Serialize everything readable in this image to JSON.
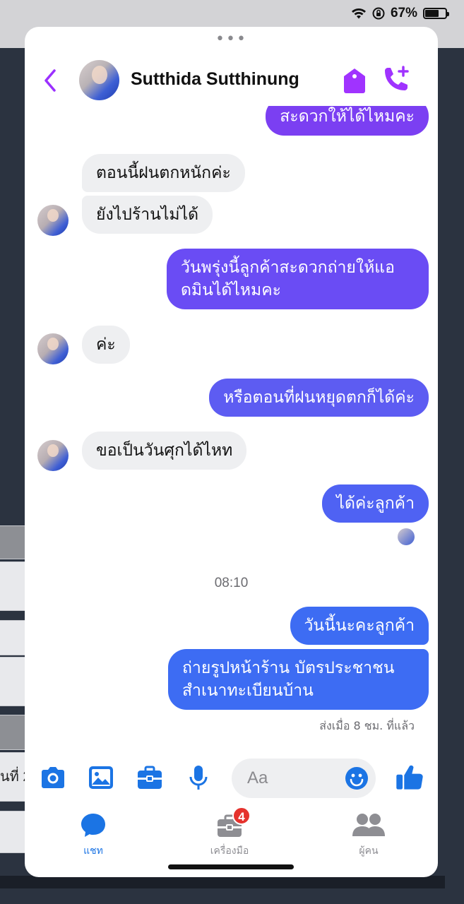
{
  "status_bar": {
    "battery": "67%",
    "battery_level": 0.67
  },
  "background": {
    "side_text": "นที่ 2"
  },
  "header": {
    "contact_name": "Sutthida Sutthinung",
    "accent_color": "#a033ff"
  },
  "messages": [
    {
      "from": "me",
      "lines": [
        "สะดวกให้ได้ไหมคะ"
      ]
    },
    {
      "from": "them",
      "lines": [
        "ตอนนี้ฝนตกหนักค่ะ"
      ]
    },
    {
      "from": "them",
      "lines": [
        "ยังไปร้านไม่ได้"
      ]
    },
    {
      "from": "me",
      "lines": [
        "วันพรุ่งนี้ลูกค้าสะดวกถ่ายให้แอ",
        "ดมินได้ไหมคะ"
      ]
    },
    {
      "from": "them",
      "lines": [
        "ค่ะ"
      ]
    },
    {
      "from": "me",
      "lines": [
        "หรือตอนที่ฝนหยุดตกก็ได้ค่ะ"
      ]
    },
    {
      "from": "them",
      "lines": [
        "ขอเป็นวันศุกได้ไหท"
      ]
    },
    {
      "from": "me",
      "lines": [
        "ได้ค่ะลูกค้า"
      ]
    },
    {
      "from": "me",
      "lines": [
        "วันนี้นะคะลูกค้า"
      ]
    },
    {
      "from": "me",
      "lines": [
        "ถ่ายรูปหน้าร้าน บัตรประชาชน",
        "สำเนาทะเบียนบ้าน"
      ]
    }
  ],
  "timestamp": "08:10",
  "sent_status": "ส่งเมื่อ 8 ชม. ที่แล้ว",
  "composer": {
    "placeholder": "Aa",
    "icons": [
      "camera-icon",
      "image-icon",
      "briefcase-icon",
      "microphone-icon",
      "emoji-icon",
      "thumbs-up-icon"
    ],
    "icon_color": "#1b74e4"
  },
  "tabs": [
    {
      "label": "แชท",
      "icon": "chat-bubble-icon",
      "active": true
    },
    {
      "label": "เครื่องมือ",
      "icon": "toolbox-icon",
      "badge": "4"
    },
    {
      "label": "ผู้คน",
      "icon": "people-icon"
    }
  ]
}
